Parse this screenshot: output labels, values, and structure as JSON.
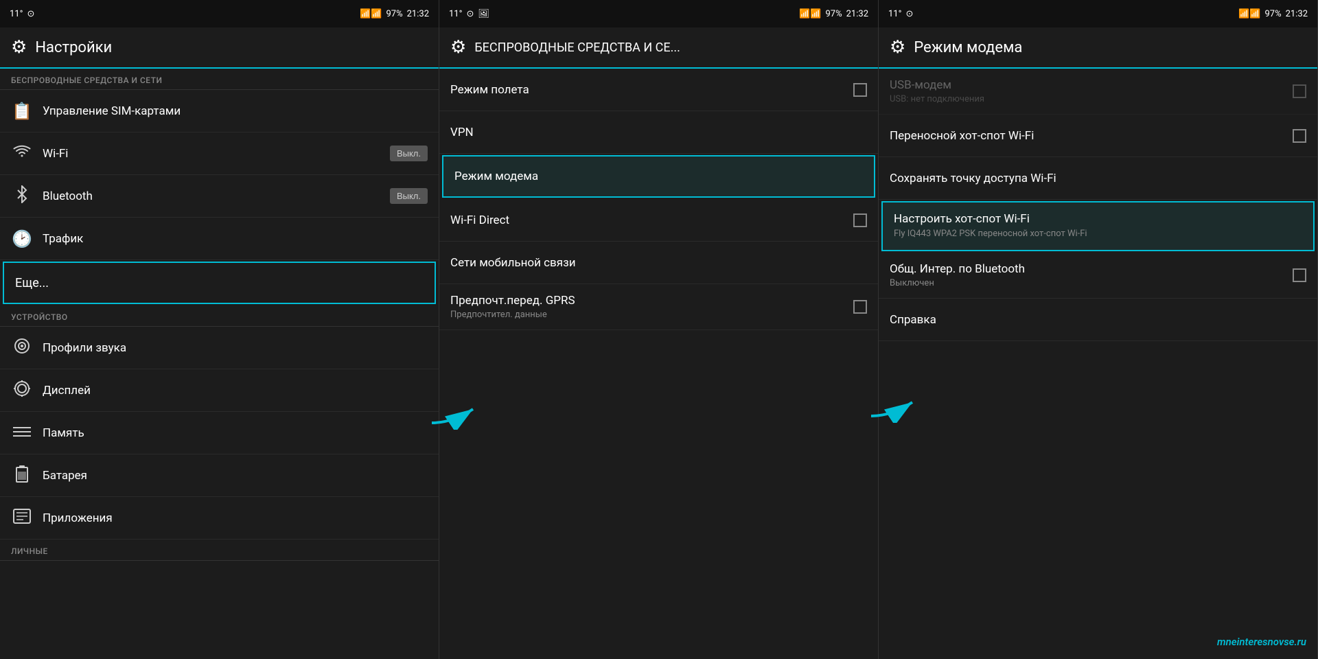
{
  "panel1": {
    "status": {
      "temp": "11°",
      "battery": "97%",
      "time": "21:32"
    },
    "header": {
      "title": "Настройки",
      "icon": "⚙"
    },
    "section1": {
      "label": "БЕСПРОВОДНЫЕ СРЕДСТВА И СЕТИ"
    },
    "items_wireless": [
      {
        "id": "sim",
        "icon": "📋",
        "label": "Управление SIM-картами",
        "toggle": null
      },
      {
        "id": "wifi",
        "icon": "📶",
        "label": "Wi-Fi",
        "toggle": "Выкл."
      },
      {
        "id": "bluetooth",
        "icon": "🅱",
        "label": "Bluetooth",
        "toggle": "Выкл."
      },
      {
        "id": "traffic",
        "icon": "🕐",
        "label": "Трафик",
        "toggle": null
      },
      {
        "id": "more",
        "icon": "",
        "label": "Еще...",
        "toggle": null,
        "highlighted": true
      }
    ],
    "section2": {
      "label": "УСТРОЙСТВО"
    },
    "items_device": [
      {
        "id": "sound",
        "icon": "✤",
        "label": "Профили звука"
      },
      {
        "id": "display",
        "icon": "✺",
        "label": "Дисплей"
      },
      {
        "id": "memory",
        "icon": "☰",
        "label": "Память"
      },
      {
        "id": "battery",
        "icon": "🔋",
        "label": "Батарея"
      },
      {
        "id": "apps",
        "icon": "📦",
        "label": "Приложения"
      }
    ],
    "section3": {
      "label": "ЛИЧНЫЕ"
    }
  },
  "panel2": {
    "status": {
      "temp": "11°",
      "battery": "97%",
      "time": "21:32"
    },
    "header": {
      "title": "БЕСПРОВОДНЫЕ СРЕДСТВА И СЕ...",
      "icon": "⚙"
    },
    "items": [
      {
        "id": "airplane",
        "label": "Режим полета",
        "sub": null,
        "checkbox": true,
        "highlighted": false
      },
      {
        "id": "vpn",
        "label": "VPN",
        "sub": null,
        "checkbox": false,
        "highlighted": false
      },
      {
        "id": "modem",
        "label": "Режим модема",
        "sub": null,
        "checkbox": false,
        "highlighted": true
      },
      {
        "id": "wifidirect",
        "label": "Wi-Fi Direct",
        "sub": null,
        "checkbox": true,
        "highlighted": false
      },
      {
        "id": "mobile",
        "label": "Сети мобильной связи",
        "sub": null,
        "checkbox": false,
        "highlighted": false
      },
      {
        "id": "gprs",
        "label": "Предпочт.перед. GPRS",
        "sub": "Предпочтител. данные",
        "checkbox": true,
        "highlighted": false
      }
    ]
  },
  "panel3": {
    "status": {
      "temp": "11°",
      "battery": "97%",
      "time": "21:32"
    },
    "header": {
      "title": "Режим модема",
      "icon": "⚙"
    },
    "items": [
      {
        "id": "usb",
        "label": "USB-модем",
        "sub": "USB: нет подключения",
        "checkbox": true,
        "highlighted": false,
        "disabled": true
      },
      {
        "id": "hotspot",
        "label": "Переносной хот-спот Wi-Fi",
        "sub": null,
        "checkbox": true,
        "highlighted": false
      },
      {
        "id": "save",
        "label": "Сохранять точку доступа Wi-Fi",
        "sub": null,
        "checkbox": false,
        "highlighted": false
      },
      {
        "id": "configure",
        "label": "Настроить хот-спот Wi-Fi",
        "sub": "Fly IQ443 WPA2 PSK переносной хот-спот Wi-Fi",
        "checkbox": false,
        "highlighted": true
      },
      {
        "id": "bluetooth_share",
        "label": "Общ. Интер. по Bluetooth",
        "sub": "Выключен",
        "checkbox": true,
        "highlighted": false
      },
      {
        "id": "help",
        "label": "Справка",
        "sub": null,
        "checkbox": false,
        "highlighted": false
      }
    ],
    "watermark": "mneinteresnovse.ru"
  }
}
